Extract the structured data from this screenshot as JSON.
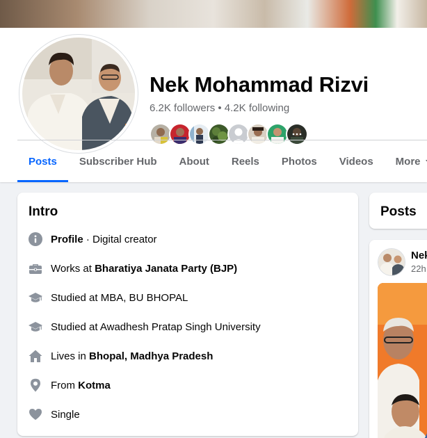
{
  "profile": {
    "name": "Nek Mohammad Rizvi",
    "follow_stats": "6.2K followers • 4.2K following",
    "friend_faces": [
      "friend-1",
      "friend-2",
      "friend-3",
      "friend-4",
      "friend-5",
      "friend-6",
      "friend-7",
      "friend-8"
    ]
  },
  "tabs": [
    {
      "label": "Posts",
      "active": true
    },
    {
      "label": "Subscriber Hub",
      "active": false
    },
    {
      "label": "About",
      "active": false
    },
    {
      "label": "Reels",
      "active": false
    },
    {
      "label": "Photos",
      "active": false
    },
    {
      "label": "Videos",
      "active": false
    },
    {
      "label": "More",
      "active": false
    }
  ],
  "intro": {
    "title": "Intro",
    "items": [
      {
        "icon": "info-icon",
        "prefix": "",
        "bold": "Profile",
        "suffix": " · Digital creator"
      },
      {
        "icon": "briefcase-icon",
        "prefix": "Works at ",
        "bold": "Bharatiya Janata Party (BJP)",
        "suffix": ""
      },
      {
        "icon": "graduation-cap-icon",
        "prefix": "Studied at MBA, BU BHOPAL",
        "bold": "",
        "suffix": ""
      },
      {
        "icon": "graduation-cap-icon",
        "prefix": "Studied at Awadhesh Pratap Singh University",
        "bold": "",
        "suffix": ""
      },
      {
        "icon": "home-icon",
        "prefix": "Lives in ",
        "bold": "Bhopal, Madhya Pradesh",
        "suffix": ""
      },
      {
        "icon": "location-pin-icon",
        "prefix": "From ",
        "bold": "Kotma",
        "suffix": ""
      },
      {
        "icon": "heart-icon",
        "prefix": "Single",
        "bold": "",
        "suffix": ""
      }
    ]
  },
  "posts": {
    "title": "Posts",
    "first_post": {
      "author": "Nek",
      "time": "22h"
    }
  },
  "colors": {
    "accent": "#0866ff",
    "secondary_text": "#65676b",
    "icon_gray": "#65676b"
  }
}
